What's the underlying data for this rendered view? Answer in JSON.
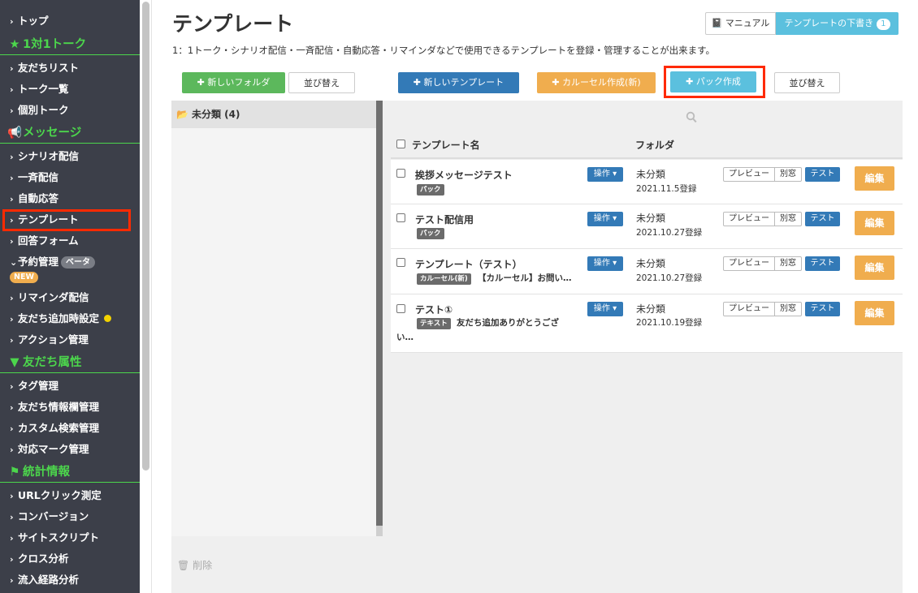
{
  "sidebar": {
    "items": [
      {
        "label": "トップ"
      },
      {
        "section": "1対1トーク",
        "icon": "star-icon"
      },
      {
        "label": "友だちリスト"
      },
      {
        "label": "トーク一覧"
      },
      {
        "label": "個別トーク"
      },
      {
        "section": "メッセージ",
        "icon": "megaphone-icon"
      },
      {
        "label": "シナリオ配信"
      },
      {
        "label": "一斉配信"
      },
      {
        "label": "自動応答"
      },
      {
        "label": "テンプレート",
        "active": true
      },
      {
        "label": "回答フォーム"
      },
      {
        "label": "予約管理",
        "badge": "ベータ",
        "badge2": "NEW"
      },
      {
        "label": "リマインダ配信"
      },
      {
        "label": "友だち追加時設定",
        "dot_color": "#f2d200"
      },
      {
        "label": "アクション管理"
      },
      {
        "section": "友だち属性",
        "icon": "filter-icon"
      },
      {
        "label": "タグ管理"
      },
      {
        "label": "友だち情報欄管理"
      },
      {
        "label": "カスタム検索管理"
      },
      {
        "label": "対応マーク管理"
      },
      {
        "section": "統計情報",
        "icon": "flag-icon"
      },
      {
        "label": "URLクリック測定"
      },
      {
        "label": "コンバージョン"
      },
      {
        "label": "サイトスクリプト"
      },
      {
        "label": "クロス分析"
      },
      {
        "label": "流入経路分析"
      }
    ]
  },
  "header": {
    "title": "テンプレート",
    "description": "1：1トーク・シナリオ配信・一斉配信・自動応答・リマインダなどで使用できるテンプレートを登録・管理することが出来ます。",
    "manual_label": "マニュアル",
    "draft_label": "テンプレートの下書き",
    "draft_count": "1"
  },
  "toolbar": {
    "new_folder": "新しいフォルダ",
    "sort_folders": "並び替え",
    "new_template": "新しいテンプレート",
    "carousel": "カルーセル作成(新)",
    "pack": "パック作成",
    "sort_templates": "並び替え"
  },
  "folders": {
    "items": [
      {
        "label": "未分類 (4)"
      }
    ],
    "delete_label": "削除"
  },
  "table": {
    "col_name": "テンプレート名",
    "col_folder": "フォルダ",
    "op_label": "操作",
    "preview_label": "プレビュー",
    "window_label": "別窓",
    "test_label": "テスト",
    "edit_label": "編集",
    "rows": [
      {
        "name": "挨拶メッセージテスト",
        "tag": "パック",
        "snippet": "",
        "folder": "未分類",
        "date": "2021.11.5登録"
      },
      {
        "name": "テスト配信用",
        "tag": "パック",
        "snippet": "",
        "folder": "未分類",
        "date": "2021.10.27登録"
      },
      {
        "name": "テンプレート（テスト）",
        "tag": "カルーセル(新)",
        "snippet": "【カルーセル】お問い…",
        "folder": "未分類",
        "date": "2021.10.27登録"
      },
      {
        "name": "テスト①",
        "tag": "テキスト",
        "snippet": "友だち追加ありがとうござ",
        "snippet2": "い…",
        "folder": "未分類",
        "date": "2021.10.19登録"
      }
    ]
  },
  "colors": {
    "sidebar_bg": "#3c3f49",
    "section_green": "#4cd64c",
    "highlight_red": "#ff2a00",
    "primary": "#337ab7",
    "success": "#5cb85c",
    "warning": "#f0ad4e",
    "info": "#5bc0de"
  }
}
